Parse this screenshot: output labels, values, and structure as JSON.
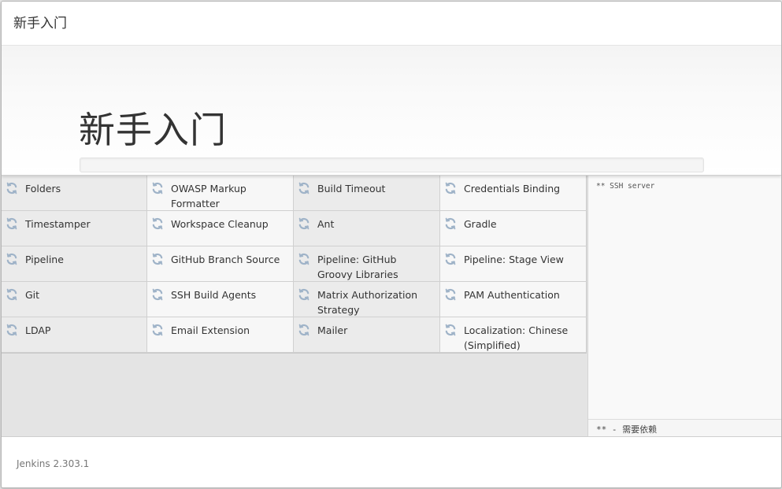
{
  "dialog": {
    "title": "新手入门"
  },
  "hero": {
    "title": "新手入门",
    "progress_fraction": 0.0
  },
  "plugins": [
    {
      "label": "Folders",
      "icon": "refresh-icon"
    },
    {
      "label": "OWASP Markup Formatter",
      "icon": "refresh-icon"
    },
    {
      "label": "Build Timeout",
      "icon": "refresh-icon"
    },
    {
      "label": "Credentials Binding",
      "icon": "refresh-icon"
    },
    {
      "label": "Timestamper",
      "icon": "refresh-icon"
    },
    {
      "label": "Workspace Cleanup",
      "icon": "refresh-icon"
    },
    {
      "label": "Ant",
      "icon": "refresh-icon"
    },
    {
      "label": "Gradle",
      "icon": "refresh-icon"
    },
    {
      "label": "Pipeline",
      "icon": "refresh-icon"
    },
    {
      "label": "GitHub Branch Source",
      "icon": "refresh-icon"
    },
    {
      "label": "Pipeline: GitHub Groovy Libraries",
      "icon": "refresh-icon"
    },
    {
      "label": "Pipeline: Stage View",
      "icon": "refresh-icon"
    },
    {
      "label": "Git",
      "icon": "refresh-icon"
    },
    {
      "label": "SSH Build Agents",
      "icon": "refresh-icon"
    },
    {
      "label": "Matrix Authorization Strategy",
      "icon": "refresh-icon"
    },
    {
      "label": "PAM Authentication",
      "icon": "refresh-icon"
    },
    {
      "label": "LDAP",
      "icon": "refresh-icon"
    },
    {
      "label": "Email Extension",
      "icon": "refresh-icon"
    },
    {
      "label": "Mailer",
      "icon": "refresh-icon"
    },
    {
      "label": "Localization: Chinese (Simplified)",
      "icon": "refresh-icon"
    }
  ],
  "log": {
    "text": "** SSH server",
    "footer": "** - 需要依赖"
  },
  "footer": {
    "version": "Jenkins 2.303.1"
  },
  "colors": {
    "icon": "#9fb3c8",
    "cell_dark": "#ebebeb",
    "cell_light": "#f7f7f7"
  }
}
